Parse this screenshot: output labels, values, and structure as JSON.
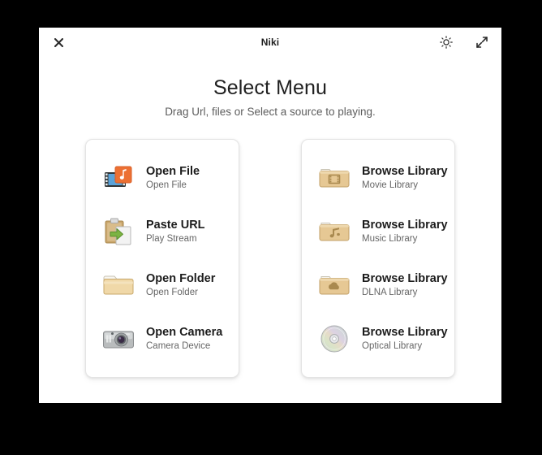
{
  "window": {
    "titlebar": {
      "title": "Niki",
      "close_icon": "close-icon",
      "brightness_icon": "sun-brightness-icon",
      "fullscreen_icon": "expand-fullscreen-icon"
    }
  },
  "header": {
    "title": "Select Menu",
    "subtitle": "Drag Url, files or Select a source to playing."
  },
  "colors": {
    "accent_orange": "#ec7033",
    "film_blue": "#5ba3d9",
    "folder_tan": "#e2c693",
    "arrow_green": "#7cb342",
    "camera_gray": "#b9bcbd",
    "disc_silver": "#d8d9db",
    "background": "#ffffff",
    "page_background": "#000000"
  },
  "left_card": {
    "items": [
      {
        "title": "Open File",
        "subtitle": "Open File",
        "icon": "film-music-file-icon"
      },
      {
        "title": "Paste URL",
        "subtitle": "Play Stream",
        "icon": "clipboard-paste-icon"
      },
      {
        "title": "Open Folder",
        "subtitle": "Open Folder",
        "icon": "open-folder-icon"
      },
      {
        "title": "Open Camera",
        "subtitle": "Camera Device",
        "icon": "camera-icon"
      }
    ]
  },
  "right_card": {
    "items": [
      {
        "title": "Browse Library",
        "subtitle": "Movie Library",
        "icon": "folder-movie-icon"
      },
      {
        "title": "Browse Library",
        "subtitle": "Music Library",
        "icon": "folder-music-icon"
      },
      {
        "title": "Browse Library",
        "subtitle": "DLNA Library",
        "icon": "folder-cloud-icon"
      },
      {
        "title": "Browse Library",
        "subtitle": "Optical Library",
        "icon": "optical-disc-icon"
      }
    ]
  }
}
